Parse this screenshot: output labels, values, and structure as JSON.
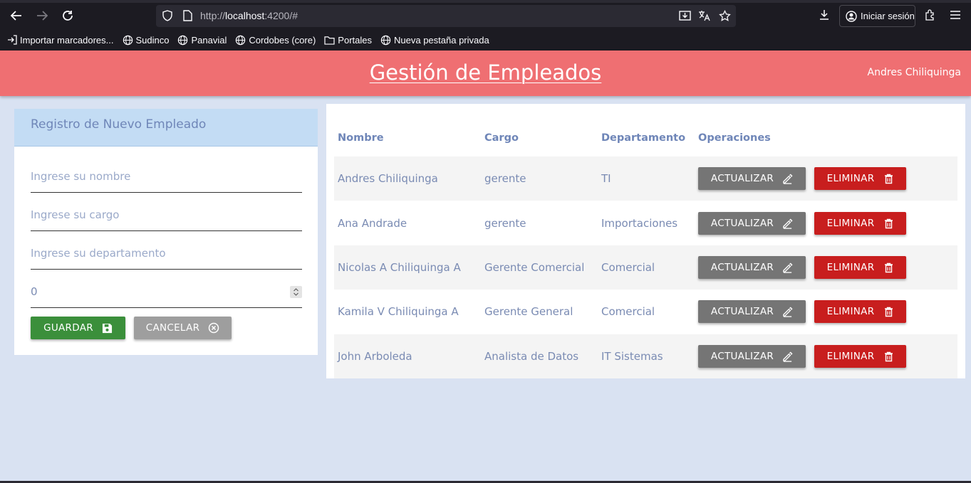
{
  "browser": {
    "url_prefix": "http://",
    "url_host": "localhost",
    "url_rest": ":4200/#",
    "signin_label": "Iniciar sesión",
    "bookmarks": [
      {
        "label": "Importar marcadores...",
        "icon": "import-icon"
      },
      {
        "label": "Sudinco",
        "icon": "globe-icon"
      },
      {
        "label": "Panavial",
        "icon": "globe-icon"
      },
      {
        "label": "Cordobes (core)",
        "icon": "globe-icon"
      },
      {
        "label": "Portales",
        "icon": "folder-icon"
      },
      {
        "label": "Nueva pestaña privada",
        "icon": "globe-icon"
      }
    ]
  },
  "header": {
    "title": "Gestión de Empleados",
    "user": "Andres Chiliquinga"
  },
  "form": {
    "title": "Registro de Nuevo Empleado",
    "name_placeholder": "Ingrese su nombre",
    "cargo_placeholder": "Ingrese su cargo",
    "dept_placeholder": "Ingrese su departamento",
    "number_value": "0",
    "save_label": "GUARDAR",
    "cancel_label": "CANCELAR"
  },
  "table": {
    "headers": {
      "nombre": "Nombre",
      "cargo": "Cargo",
      "departamento": "Departamento",
      "operaciones": "Operaciones"
    },
    "update_label": "ACTUALIZAR",
    "delete_label": "ELIMINAR",
    "rows": [
      {
        "nombre": "Andres Chiliquinga",
        "cargo": "gerente",
        "departamento": "TI"
      },
      {
        "nombre": "Ana Andrade",
        "cargo": "gerente",
        "departamento": "Importaciones"
      },
      {
        "nombre": "Nicolas A Chiliquinga A",
        "cargo": "Gerente Comercial",
        "departamento": "Comercial"
      },
      {
        "nombre": "Kamila V Chiliquinga A",
        "cargo": "Gerente General",
        "departamento": "Comercial"
      },
      {
        "nombre": "John Arboleda",
        "cargo": "Analista de Datos",
        "departamento": "IT Sistemas"
      }
    ]
  },
  "colors": {
    "header_bg": "#ef6f72",
    "save_bg": "#3b8f3b",
    "cancel_bg": "#9e9e9e",
    "update_bg": "#757575",
    "delete_bg": "#c81e1e",
    "page_bg": "#d9e2f2"
  }
}
